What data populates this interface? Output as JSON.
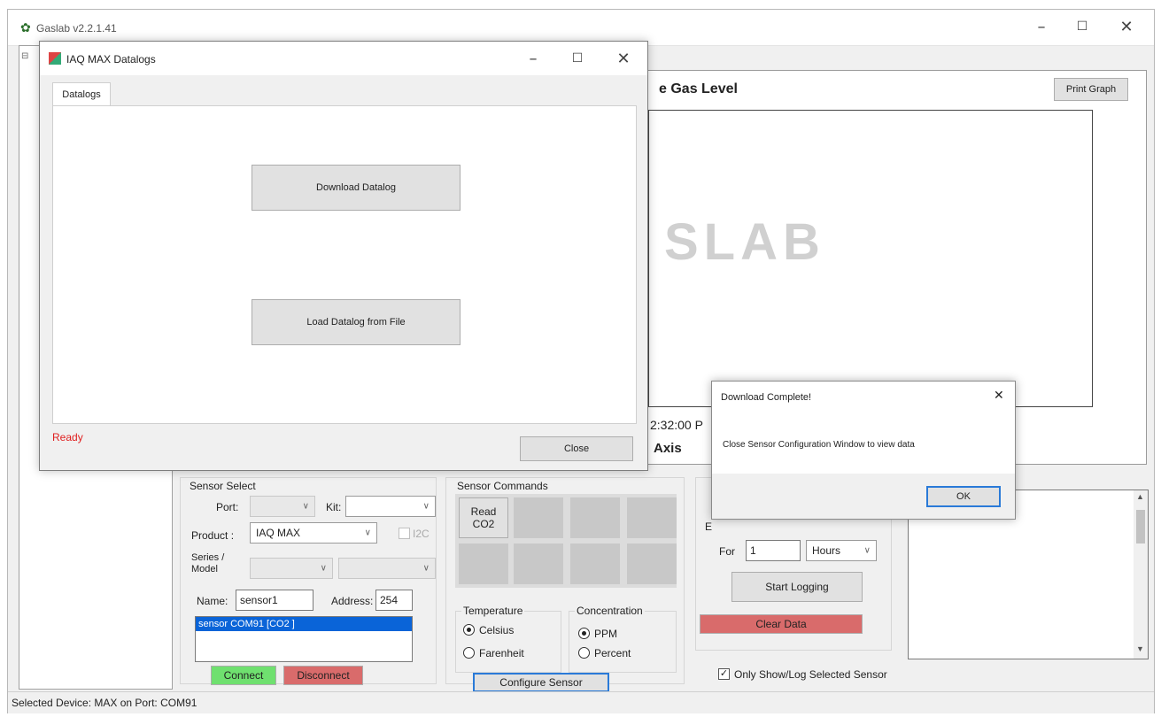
{
  "main": {
    "title": "Gaslab v2.2.1.41",
    "menu_partial": "... ... ...",
    "graph": {
      "title_fragment": "e Gas Level",
      "print_button": "Print Graph",
      "watermark": "SLAB",
      "time_label": "2:32:00 P",
      "axis_label": "Axis"
    },
    "sensor_select": {
      "group_label": "Sensor Select",
      "port_label": "Port:",
      "port_value": "",
      "kit_label": "Kit:",
      "kit_value": "",
      "product_label": "Product :",
      "product_value": "IAQ MAX",
      "i2c_label": "I2C",
      "series_label": "Series /\nModel",
      "name_label": "Name:",
      "name_value": "sensor1",
      "address_label": "Address:",
      "address_value": "254",
      "list_item": "sensor COM91 [CO2 ]",
      "connect_button": "Connect",
      "disconnect_button": "Disconnect"
    },
    "sensor_commands": {
      "group_label": "Sensor Commands",
      "read_co2_line1": "Read",
      "read_co2_line2": "CO2",
      "temperature_label": "Temperature",
      "celsius_label": "Celsius",
      "farenheit_label": "Farenheit",
      "concentration_label": "Concentration",
      "ppm_label": "PPM",
      "percent_label": "Percent",
      "configure_button": "Configure Sensor"
    },
    "logging": {
      "every_label_fragment": "E",
      "for_label": "For",
      "for_value": "1",
      "unit_value": "Hours",
      "start_button": "Start Logging",
      "clear_button": "Clear Data",
      "only_show_label": "Only Show/Log Selected Sensor"
    },
    "status_bar": "Selected Device: MAX on Port: COM91"
  },
  "datalogs_dialog": {
    "title": "IAQ MAX Datalogs",
    "tab_label": "Datalogs",
    "download_button": "Download Datalog",
    "load_button": "Load Datalog from File",
    "status": "Ready",
    "close_button": "Close"
  },
  "download_dialog": {
    "title": "Download Complete!",
    "message": "Close Sensor Configuration Window to view data",
    "ok_button": "OK"
  },
  "colors": {
    "connect_green": "#6fe06f",
    "disconnect_red": "#d96b6b",
    "clear_red": "#d96b6b",
    "status_red": "#e02020",
    "selection_blue": "#0a64d8"
  },
  "icons": {
    "app_icon": "gear-icon",
    "dialog_icon": "app-grid-icon"
  }
}
